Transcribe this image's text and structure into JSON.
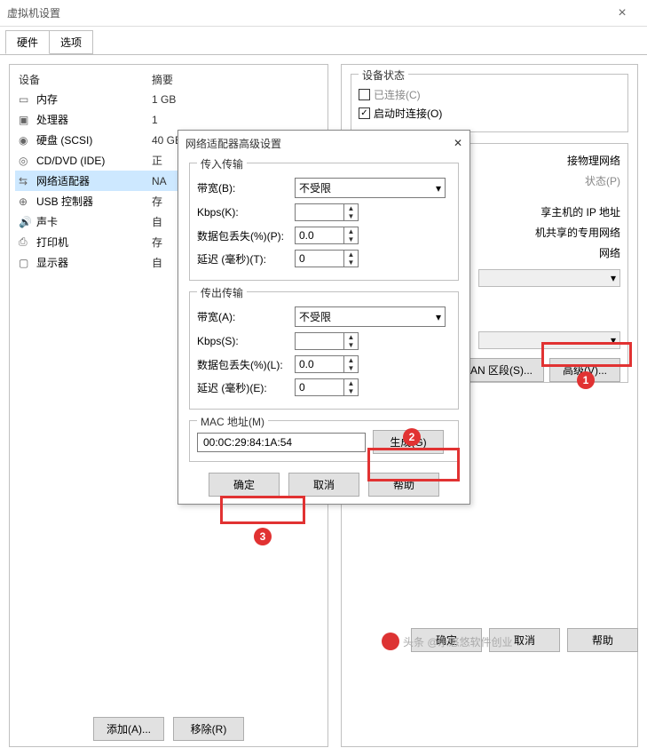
{
  "window": {
    "title": "虚拟机设置"
  },
  "tabs": {
    "hardware": "硬件",
    "options": "选项"
  },
  "deviceHeader": {
    "device": "设备",
    "summary": "摘要"
  },
  "devices": [
    {
      "icon": "memory-icon",
      "name": "内存",
      "summary": "1 GB"
    },
    {
      "icon": "cpu-icon",
      "name": "处理器",
      "summary": "1"
    },
    {
      "icon": "disk-icon",
      "name": "硬盘 (SCSI)",
      "summary": "40 GB"
    },
    {
      "icon": "cd-icon",
      "name": "CD/DVD (IDE)",
      "summary": "正"
    },
    {
      "icon": "network-icon",
      "name": "网络适配器",
      "summary": "NA"
    },
    {
      "icon": "usb-icon",
      "name": "USB 控制器",
      "summary": "存"
    },
    {
      "icon": "sound-icon",
      "name": "声卡",
      "summary": "自"
    },
    {
      "icon": "printer-icon",
      "name": "打印机",
      "summary": "存"
    },
    {
      "icon": "display-icon",
      "name": "显示器",
      "summary": "自"
    }
  ],
  "deviceStatus": {
    "title": "设备状态",
    "connected": "已连接(C)",
    "connectedChecked": false,
    "connectOnStart": "启动时连接(O)",
    "connectOnStartChecked": true
  },
  "netGroup": {
    "partial1": "接物理网络",
    "partial2": "状态(P)",
    "partial3": "享主机的 IP 地址",
    "partial4": "机共享的专用网络",
    "partial5": "网络",
    "lanSeg": "LAN 区段(S)...",
    "advanced": "高级(V)..."
  },
  "leftBtns": {
    "add": "添加(A)...",
    "remove": "移除(R)"
  },
  "mainBtns": {
    "ok": "确定",
    "cancel": "取消",
    "help": "帮助"
  },
  "advDialog": {
    "title": "网络适配器高级设置",
    "incoming": "传入传输",
    "outgoing": "传出传输",
    "bandwidthB": "带宽(B):",
    "bandwidthA": "带宽(A):",
    "bandwidthVal": "不受限",
    "kbpsK": "Kbps(K):",
    "kbpsS": "Kbps(S):",
    "kbpsVal": "",
    "lossP": "数据包丢失(%)(P):",
    "lossL": "数据包丢失(%)(L):",
    "lossVal": "0.0",
    "latencyT": "延迟 (毫秒)(T):",
    "latencyE": "延迟 (毫秒)(E):",
    "latencyVal": "0",
    "macTitle": "MAC 地址(M)",
    "macVal": "00:0C:29:84:1A:54",
    "generate": "生成(G)",
    "ok": "确定",
    "cancel": "取消",
    "help": "帮助"
  },
  "badges": {
    "b1": "1",
    "b2": "2",
    "b3": "3"
  },
  "watermark": "头条 @乐悠悠软件创业"
}
